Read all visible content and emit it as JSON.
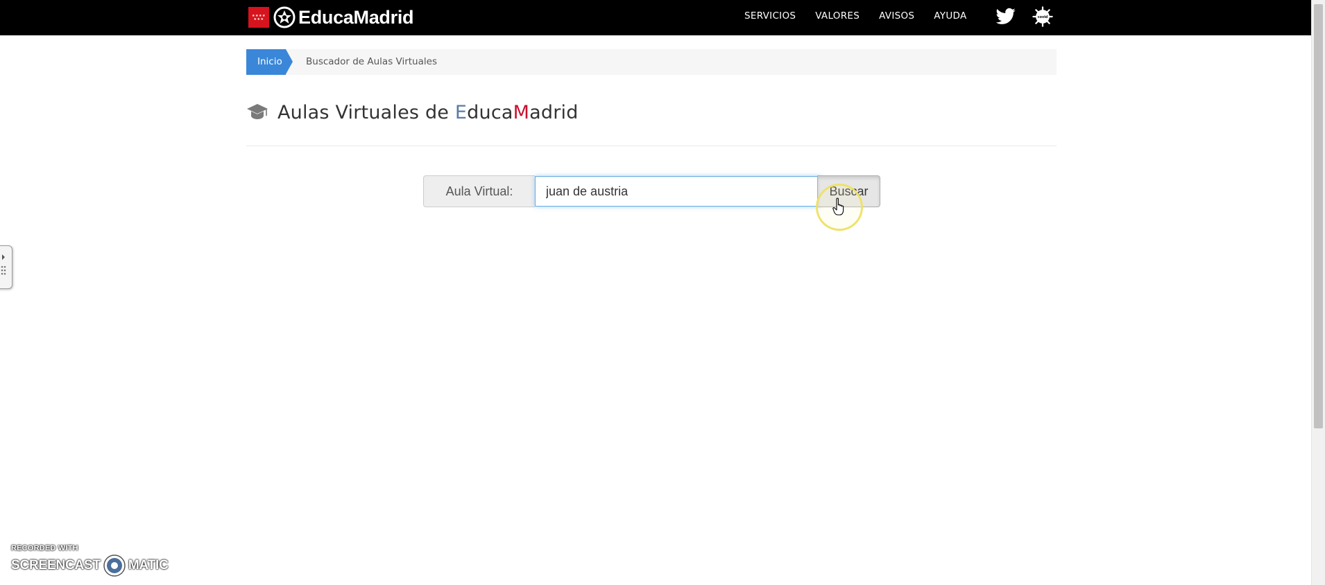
{
  "header": {
    "brand_name": "EducaMadrid",
    "nav": [
      {
        "label": "SERVICIOS"
      },
      {
        "label": "VALORES"
      },
      {
        "label": "AVISOS"
      },
      {
        "label": "AYUDA"
      }
    ],
    "icons": [
      "twitter-icon",
      "covid-icon"
    ],
    "covid_icon_text": "covid"
  },
  "breadcrumb": {
    "home": "Inicio",
    "current": "Buscador de Aulas Virtuales"
  },
  "page": {
    "title_prefix": "Aulas Virtuales de ",
    "title_e": "E",
    "title_duca": "duca",
    "title_m": "M",
    "title_adrid": "adrid",
    "icon": "graduation-cap-icon"
  },
  "search": {
    "label": "Aula Virtual:",
    "value": "juan de austria",
    "button_label": "Buscar"
  },
  "watermark": {
    "line1": "RECORDED WITH",
    "line2a": "SCREENCAST",
    "line2b": "MATIC"
  },
  "colors": {
    "navbar": "#000000",
    "breadcrumb_active": "#3a87d9",
    "title_e": "#5a7aa8",
    "title_m": "#c8102e",
    "flag_red": "#d7131d",
    "cursor_highlight": "#eee064"
  }
}
